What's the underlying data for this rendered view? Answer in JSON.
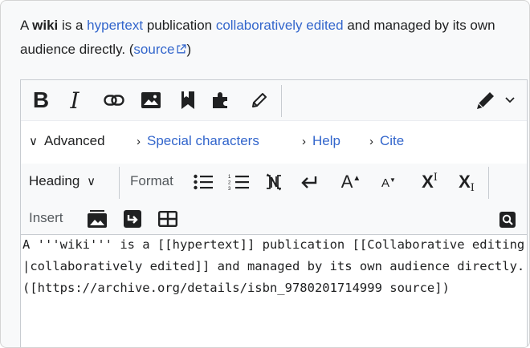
{
  "intro": {
    "t1": "A ",
    "bold": "wiki",
    "t2": " is a ",
    "link1": "hypertext",
    "t3": " publication ",
    "link2": "collaboratively edited",
    "t4": " and managed by its own audience directly. (",
    "source_link": "source",
    "t5": ")"
  },
  "toolbar": {
    "bold_label": "B",
    "italic_label": "I",
    "advanced_label": "Advanced",
    "special_label": "Special characters",
    "help_label": "Help",
    "cite_label": "Cite",
    "heading_label": "Heading",
    "format_label": "Format",
    "insert_label": "Insert",
    "big_label": "A",
    "small_label": "A",
    "sup_label": "X",
    "sup_mark": "I",
    "sub_label": "X",
    "sub_mark": "I"
  },
  "editor": {
    "content": "A '''wiki''' is a [[hypertext]] publication [[Collaborative editing|collaboratively edited]] and managed by its own audience directly. ([https://archive.org/details/isbn_9780201714999 source])"
  },
  "colors": {
    "link": "#3366cc",
    "text": "#202122",
    "toolbar_bg": "#f8f9fa"
  }
}
